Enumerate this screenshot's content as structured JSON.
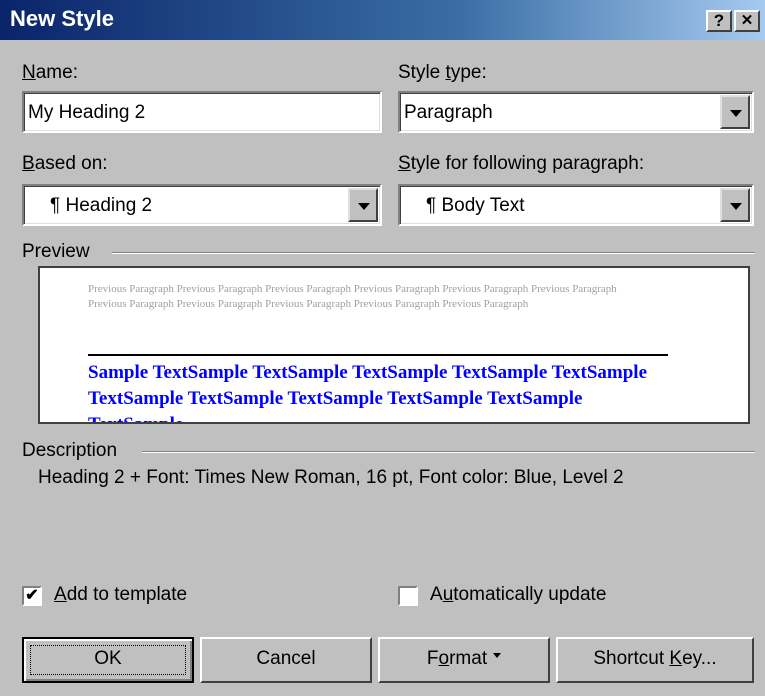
{
  "window": {
    "title": "New Style",
    "help_label": "?",
    "close_label": "✕"
  },
  "fields": {
    "name": {
      "label": "Name:",
      "value": "My Heading 2"
    },
    "style_type": {
      "label": "Style type:",
      "value": "Paragraph"
    },
    "based_on": {
      "label": "Based on:",
      "value": "¶ Heading 2"
    },
    "following": {
      "label": "Style for following paragraph:",
      "value": "¶ Body Text"
    }
  },
  "preview": {
    "label": "Preview",
    "previous_paragraph": "Previous Paragraph Previous Paragraph Previous Paragraph Previous Paragraph Previous Paragraph Previous Paragraph Previous Paragraph Previous Paragraph Previous Paragraph Previous Paragraph Previous Paragraph",
    "sample_text": "Sample TextSample TextSample TextSample TextSample TextSample TextSample TextSample TextSample TextSample TextSample TextSample"
  },
  "description": {
    "label": "Description",
    "text": "Heading 2 + Font: Times New Roman, 16 pt, Font color: Blue, Level 2"
  },
  "options": {
    "add_to_template": {
      "label": "Add to template",
      "checked": true
    },
    "auto_update": {
      "label": "Automatically update",
      "checked": false
    }
  },
  "buttons": {
    "ok": "OK",
    "cancel": "Cancel",
    "format": "Format",
    "shortcut": "Shortcut Key..."
  },
  "colors": {
    "title_start": "#0a246a",
    "title_end": "#a6caf0",
    "sample_text": "#0000ff",
    "dialog_bg": "#c0c0c0"
  }
}
